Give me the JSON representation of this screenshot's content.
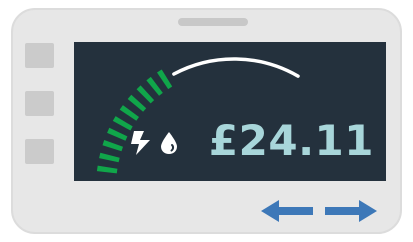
{
  "display": {
    "amount": "£24.11"
  },
  "gauge": {
    "level": 0.55,
    "filled_color": "#10a64a",
    "empty_color": "#ffffff"
  },
  "icons": {
    "energy": "lightning-icon",
    "water": "water-drop-icon",
    "prev": "arrow-left-icon",
    "next": "arrow-right-icon"
  },
  "colors": {
    "screen_bg": "#24313d",
    "reading": "#a8d6da",
    "arrows": "#3d78b8",
    "body": "#e7e7e7"
  }
}
